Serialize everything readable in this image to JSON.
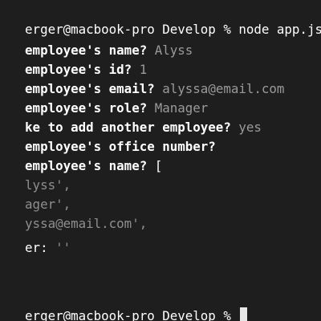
{
  "terminal": {
    "lines": [
      {
        "prompt": "erger@macbook-pro Develop % ",
        "command": "node app.js"
      },
      {
        "q": "employee's name? ",
        "a": "Alyss"
      },
      {
        "q": "employee's id? ",
        "a": "1"
      },
      {
        "q": "employee's email? ",
        "a": "alyssa@email.com"
      },
      {
        "q": "employee's role? ",
        "a": "Manager"
      },
      {
        "q": "ke to add another employee? ",
        "a": "yes"
      },
      {
        "q": "employee's office number? ",
        "a": ""
      },
      {
        "q": "employee's name? ",
        "a": "["
      }
    ],
    "object": {
      "name": "lyss',",
      "role": "ager',",
      "email": "yssa@email.com',",
      "office_key": "er: ",
      "office_val": "''"
    },
    "final_prompt": "erger@macbook-pro Develop % "
  }
}
